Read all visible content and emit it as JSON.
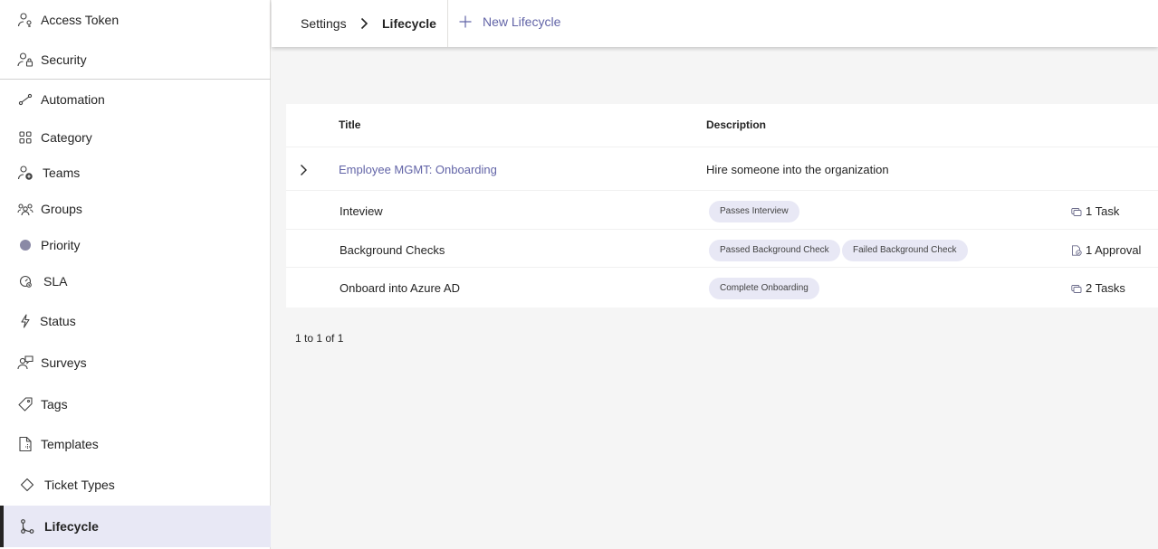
{
  "sidebar": {
    "items": [
      {
        "label": "Access Token",
        "icon": "person-key-icon"
      },
      {
        "label": "Security",
        "icon": "person-lock-icon"
      },
      {
        "label": "Automation",
        "icon": "flow-icon"
      },
      {
        "label": "Category",
        "icon": "grid-icon"
      },
      {
        "label": "Teams",
        "icon": "people-add-icon"
      },
      {
        "label": "Groups",
        "icon": "people-community-icon"
      },
      {
        "label": "Priority",
        "icon": "circle-icon"
      },
      {
        "label": "SLA",
        "icon": "gauge-icon"
      },
      {
        "label": "Status",
        "icon": "flash-icon"
      },
      {
        "label": "Surveys",
        "icon": "person-feedback-icon"
      },
      {
        "label": "Tags",
        "icon": "tag-icon"
      },
      {
        "label": "Templates",
        "icon": "document-icon"
      },
      {
        "label": "Ticket Types",
        "icon": "diamond-icon"
      },
      {
        "label": "Lifecycle",
        "icon": "branch-icon",
        "active": true
      }
    ]
  },
  "header": {
    "breadcrumb_root": "Settings",
    "breadcrumb_current": "Lifecycle",
    "new_button_label": "New Lifecycle"
  },
  "table": {
    "columns": {
      "title": "Title",
      "description": "Description"
    },
    "lifecycle": {
      "title": "Employee MGMT: Onboarding",
      "description": "Hire someone into the organization",
      "expanded": false
    },
    "stages": [
      {
        "title": "Inteview",
        "transitions": [
          "Passes Interview"
        ],
        "count": "1 Task",
        "count_icon": "task-icon"
      },
      {
        "title": "Background Checks",
        "transitions": [
          "Passed Background Check",
          "Failed Background Check"
        ],
        "count": "1 Approval",
        "count_icon": "approval-icon"
      },
      {
        "title": "Onboard into Azure AD",
        "transitions": [
          "Complete Onboarding"
        ],
        "count": "2 Tasks",
        "count_icon": "task-icon"
      }
    ]
  },
  "pagination": {
    "text": "1 to 1 of 1"
  },
  "colors": {
    "accent": "#6264a7",
    "pill_bg": "#e8e8f5",
    "active_bg": "#e8e8f5"
  }
}
